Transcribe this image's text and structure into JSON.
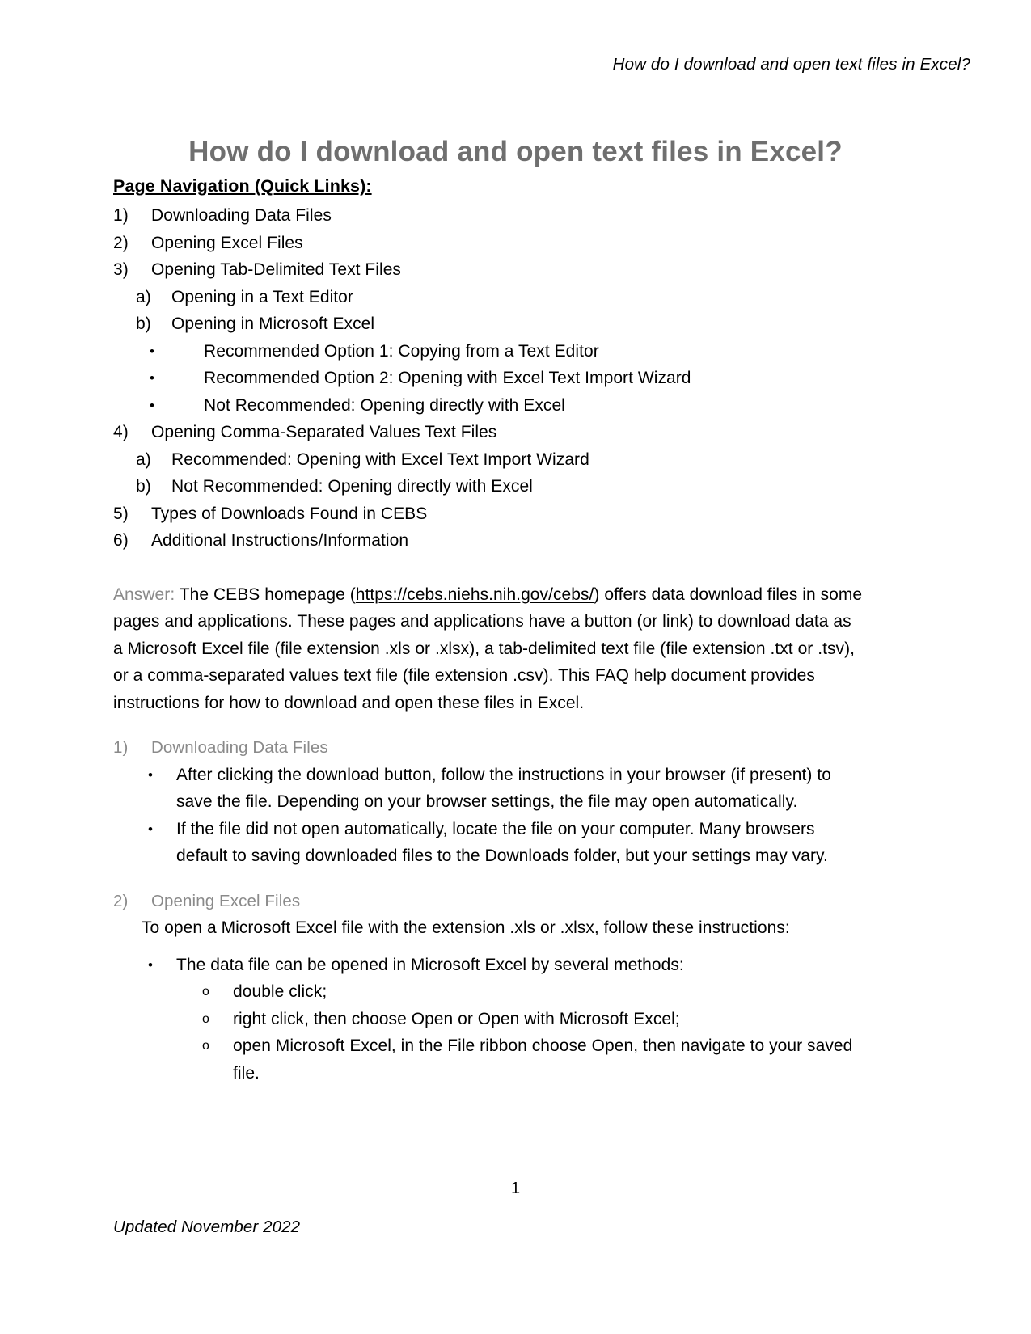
{
  "header": {
    "running_title": "How do I download and open text files in Excel?"
  },
  "title": "How do I download and open text files in Excel?",
  "navigation": {
    "heading": "Page Navigation (Quick Links):",
    "items": [
      {
        "marker": "1)",
        "level": 1,
        "label": "Downloading Data Files"
      },
      {
        "marker": "2)",
        "level": 1,
        "label": "Opening Excel Files"
      },
      {
        "marker": "3)",
        "level": 1,
        "label": "Opening Tab-Delimited Text Files"
      },
      {
        "marker": "a)",
        "level": 2,
        "label": "Opening in a Text Editor"
      },
      {
        "marker": "b)",
        "level": 2,
        "label": "Opening in Microsoft Excel"
      },
      {
        "marker": "•",
        "level": 3,
        "label": "Recommended Option 1: Copying from a Text Editor"
      },
      {
        "marker": "•",
        "level": 3,
        "label": "Recommended Option 2: Opening with Excel Text Import Wizard"
      },
      {
        "marker": "•",
        "level": 3,
        "label": "Not Recommended: Opening directly with Excel"
      },
      {
        "marker": "4)",
        "level": 1,
        "label": "Opening Comma-Separated Values Text Files"
      },
      {
        "marker": "a)",
        "level": 2,
        "label": "Recommended: Opening with Excel Text Import Wizard"
      },
      {
        "marker": "b)",
        "level": 2,
        "label": "Not Recommended: Opening directly with Excel"
      },
      {
        "marker": "5)",
        "level": 1,
        "label": "Types of Downloads Found in CEBS"
      },
      {
        "marker": "6)",
        "level": 1,
        "label": "Additional Instructions/Information"
      }
    ]
  },
  "answer": {
    "label": "Answer:",
    "text_before_link": " The CEBS homepage (",
    "link_text": "https://cebs.niehs.nih.gov/cebs/",
    "text_after_link": ") offers data download files in some pages and applications. These pages and applications have a button (or link) to download data as a Microsoft Excel file (file extension .xls or .xlsx), a tab-delimited text file (file extension .txt or .tsv), or a comma-separated values text file (file extension .csv). This FAQ help document provides instructions for how to download and open these files in Excel."
  },
  "sections": [
    {
      "marker": "1)",
      "heading": "Downloading Data Files",
      "bullets": [
        "After clicking the download button, follow the instructions in your browser (if present) to save the file. Depending on your browser settings, the file may open automatically.",
        "If the file did not open automatically, locate the file on your computer. Many browsers default to saving downloaded files to the Downloads folder, but your settings may vary."
      ]
    },
    {
      "marker": "2)",
      "heading": "Opening Excel Files",
      "intro": "To open a Microsoft Excel file with the extension .xls or .xlsx, follow these instructions:",
      "bullets": [
        "The data file can be opened in Microsoft Excel by several methods:"
      ],
      "sub_bullets": [
        "double click;",
        "right click, then choose Open or Open with Microsoft Excel;",
        "open Microsoft Excel, in the File ribbon choose Open, then navigate to your saved file."
      ]
    }
  ],
  "footer": {
    "page_number": "1",
    "updated": "Updated November 2022"
  },
  "markers": {
    "bullet": "•",
    "circle": "o"
  },
  "colors": {
    "heading_gray": "#8a8a8a",
    "title_gray": "#6f6f6f",
    "text_black": "#000000"
  }
}
